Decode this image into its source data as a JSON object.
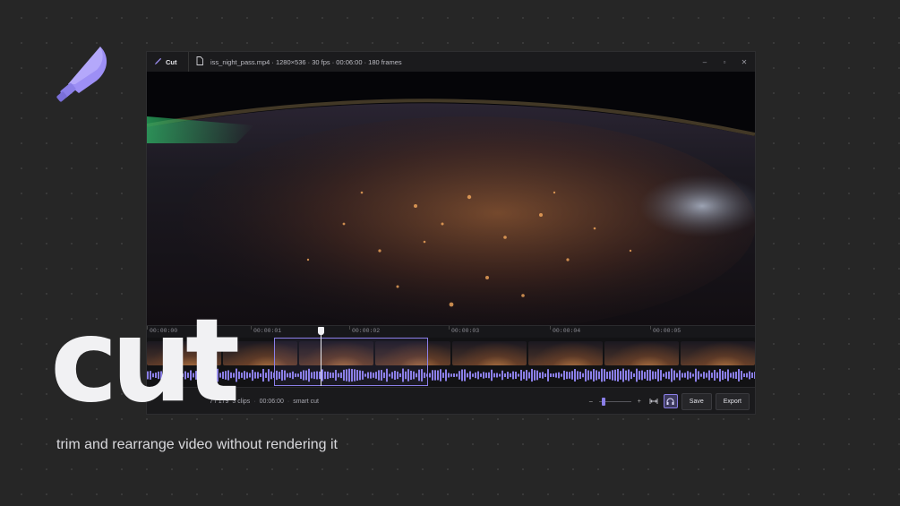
{
  "brand": {
    "logo_icon": "knife-icon",
    "accent": "#8b7fe8"
  },
  "window": {
    "app_icon": "knife-icon",
    "app_name": "Cut",
    "file_icon": "file-icon",
    "file_info": "iss_night_pass.mp4 · 1280×536 · 30 fps · 00:06:00 · 180 frames",
    "controls": {
      "minimize": "–",
      "maximize": "▫",
      "close": "✕"
    }
  },
  "timeline": {
    "ticks": [
      "00:00:00",
      "00:00:01",
      "00:00:02",
      "00:00:03",
      "00:00:04",
      "00:00:05"
    ]
  },
  "status": {
    "frame": "7 / 179",
    "clips": "3 clips",
    "duration": "00:06:00",
    "mode": "smart cut"
  },
  "toolbar": {
    "zoom_out": "–",
    "zoom_in": "+",
    "zoom_level": 0.1,
    "fit_icon": "fit-width-icon",
    "audio_icon": "headphones-icon",
    "save_label": "Save",
    "export_label": "Export"
  },
  "hero": {
    "word": "cut",
    "tagline": "trim and rearrange video without rendering it"
  }
}
